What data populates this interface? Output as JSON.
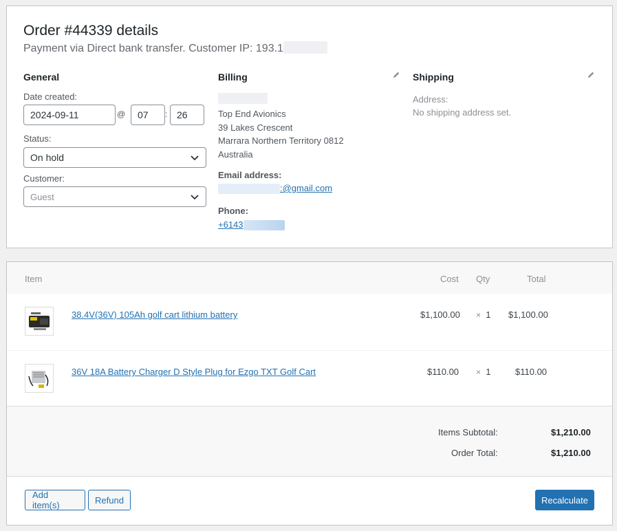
{
  "order": {
    "title": "Order #44339 details",
    "subtitle": "Payment via Direct bank transfer. Customer IP: 193.1"
  },
  "general": {
    "heading": "General",
    "date_label": "Date created:",
    "date_value": "2024-09-11",
    "at_sign": "@",
    "hour": "07",
    "colon": ":",
    "minute": "26",
    "status_label": "Status:",
    "status_value": "On hold",
    "customer_label": "Customer:",
    "customer_placeholder": "Guest"
  },
  "billing": {
    "heading": "Billing",
    "company": "Top End Avionics",
    "street": "39 Lakes Crescent",
    "city_line": "Marrara Northern Territory 0812",
    "country": "Australia",
    "email_label": "Email address:",
    "email_visible": ":@gmail.com",
    "phone_label": "Phone:",
    "phone_visible": "+6143"
  },
  "shipping": {
    "heading": "Shipping",
    "address_label": "Address:",
    "address_value": "No shipping address set."
  },
  "items_table": {
    "headers": {
      "item": "Item",
      "cost": "Cost",
      "qty": "Qty",
      "total": "Total"
    },
    "rows": [
      {
        "name": "38.4V(36V) 105Ah golf cart lithium battery",
        "cost": "$1,100.00",
        "times": "×",
        "qty": "1",
        "total": "$1,100.00",
        "thumb_icon": "battery-product-icon"
      },
      {
        "name": "36V 18A Battery Charger D Style Plug for Ezgo TXT Golf Cart",
        "cost": "$110.00",
        "times": "×",
        "qty": "1",
        "total": "$110.00",
        "thumb_icon": "charger-product-icon"
      }
    ]
  },
  "totals": {
    "subtotal_label": "Items Subtotal:",
    "subtotal_value": "$1,210.00",
    "order_total_label": "Order Total:",
    "order_total_value": "$1,210.00"
  },
  "actions": {
    "add_items": "Add item(s)",
    "refund": "Refund",
    "recalculate": "Recalculate"
  },
  "colors": {
    "accent": "#2271b1",
    "border": "#c3c4c7",
    "background": "#f0f0f1"
  }
}
